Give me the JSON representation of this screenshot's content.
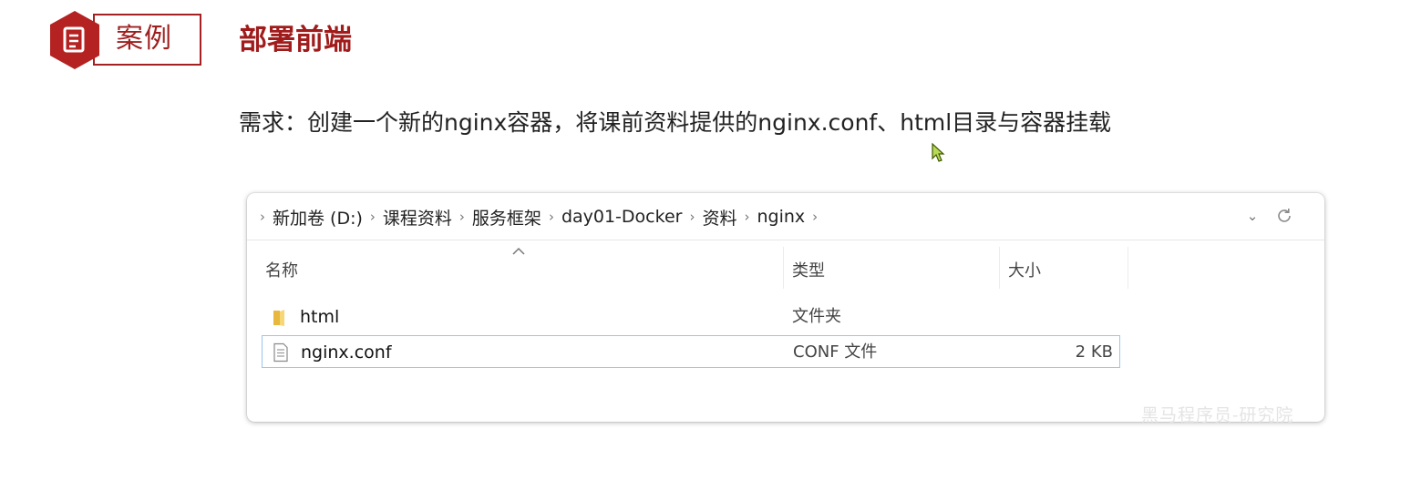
{
  "slide": {
    "badge_label": "案例",
    "title": "部署前端",
    "requirement": "需求：创建一个新的nginx容器，将课前资料提供的nginx.conf、html目录与容器挂载",
    "accent_color": "#a32121",
    "badge_icon": "document-icon"
  },
  "explorer": {
    "breadcrumbs": [
      "新加卷 (D:)",
      "课程资料",
      "服务框架",
      "day01-Docker",
      "资料",
      "nginx"
    ],
    "columns": {
      "name": "名称",
      "type": "类型",
      "size": "大小"
    },
    "files": [
      {
        "name": "html",
        "type": "文件夹",
        "size": "",
        "icon": "folder-icon"
      },
      {
        "name": "nginx.conf",
        "type": "CONF 文件",
        "size": "2 KB",
        "icon": "file-icon",
        "selected": true
      }
    ]
  },
  "watermark": "黑马程序员-研究院"
}
